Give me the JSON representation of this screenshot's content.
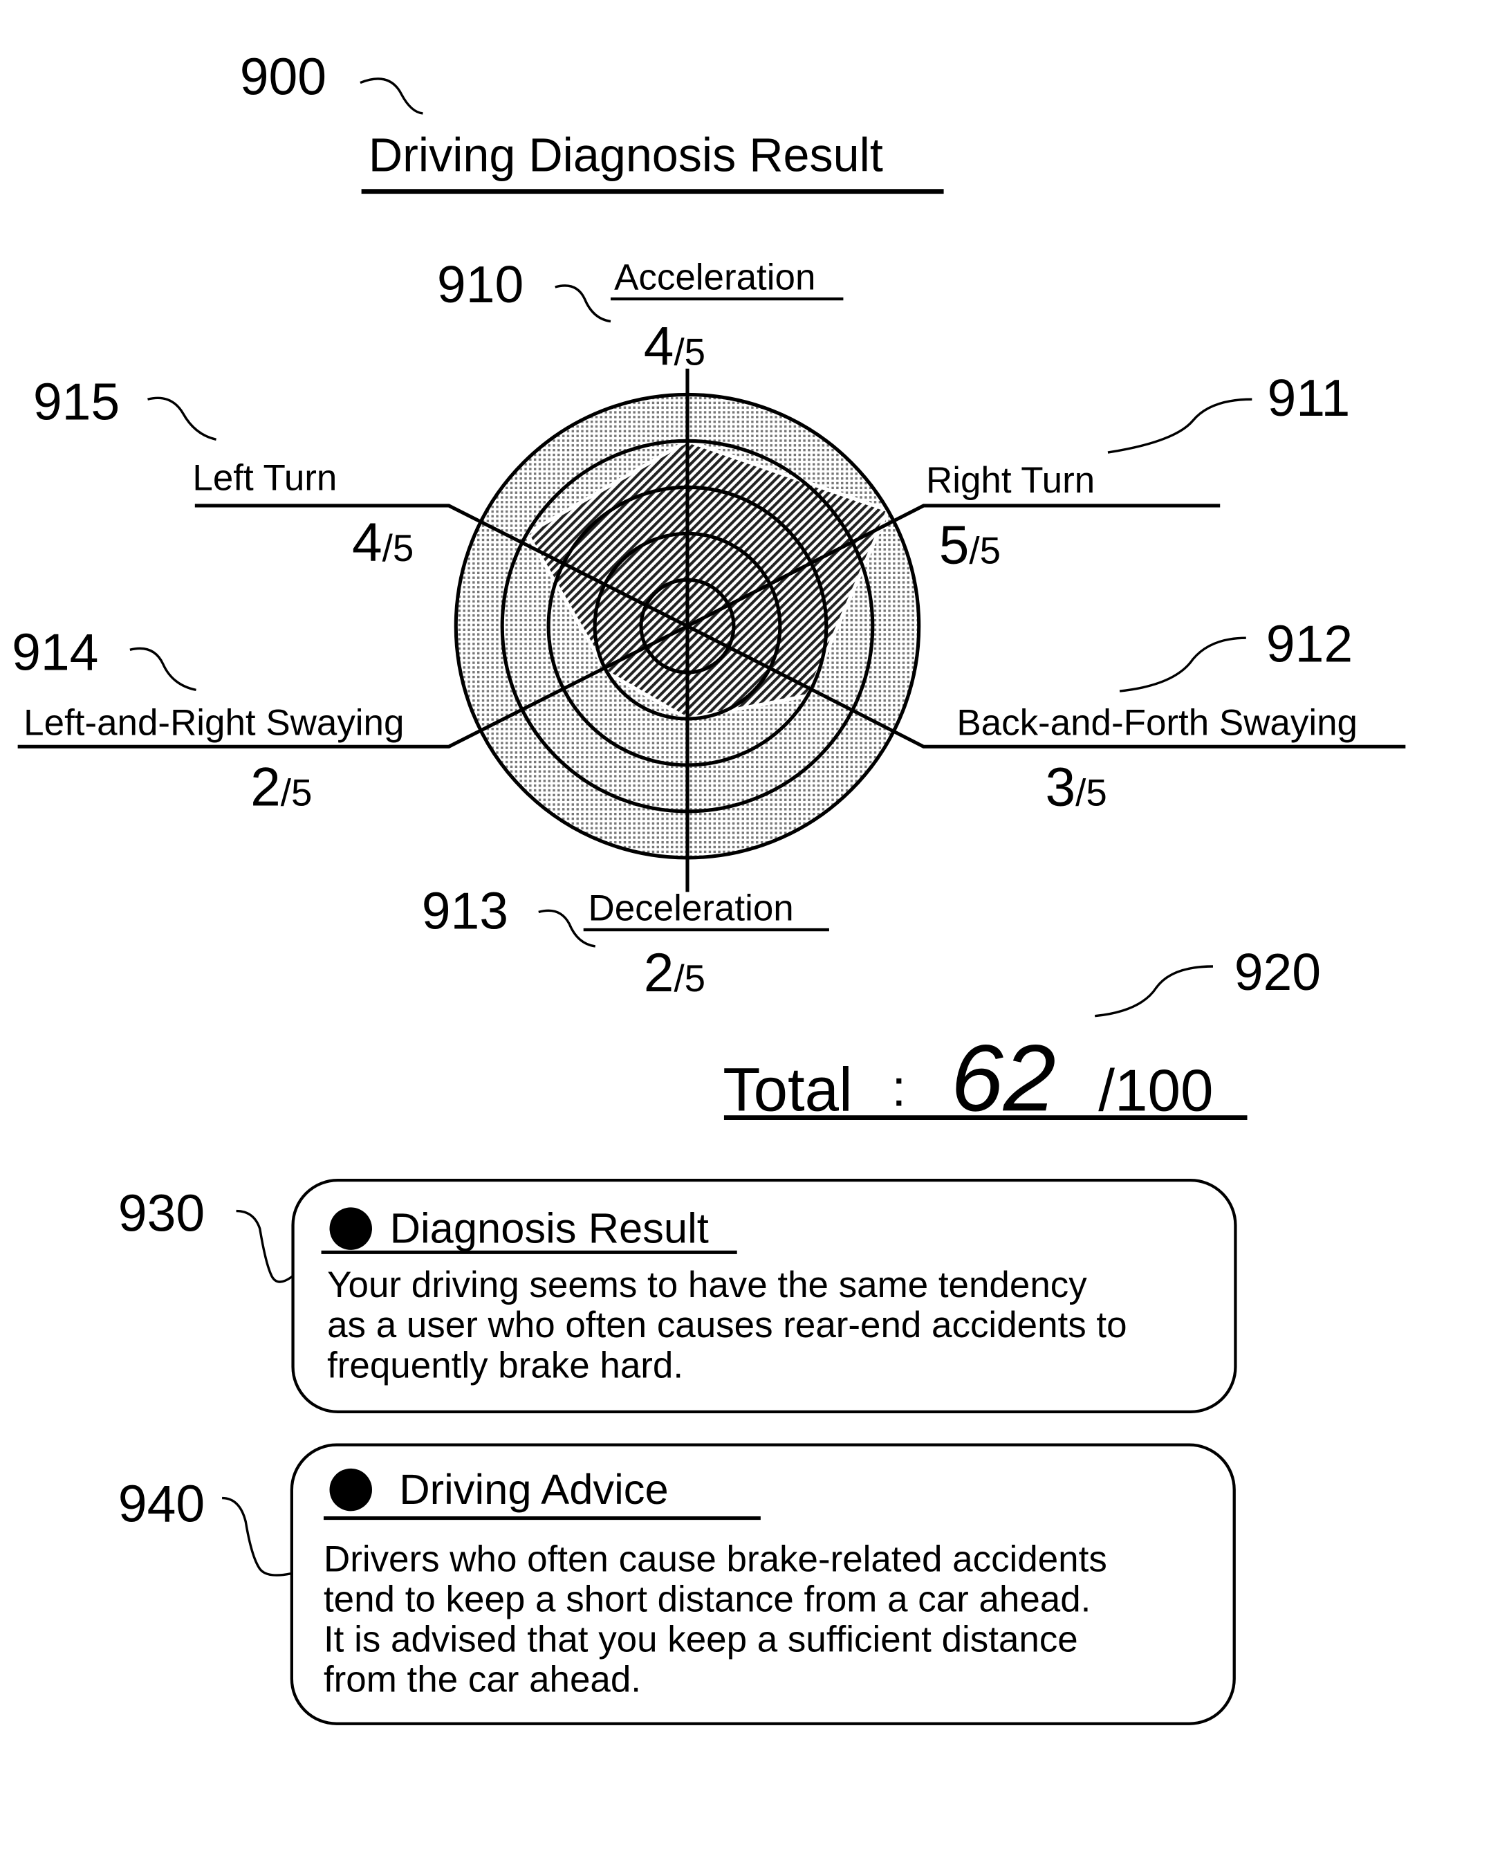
{
  "figure_ref": "900",
  "title": "Driving Diagnosis Result",
  "chart_data": {
    "type": "radar",
    "max": 5,
    "axes": [
      {
        "ref": "910",
        "name": "Acceleration",
        "score": 4,
        "max_label": "/5"
      },
      {
        "ref": "911",
        "name": "Right Turn",
        "score": 5,
        "max_label": "/5"
      },
      {
        "ref": "912",
        "name": "Back-and-Forth Swaying",
        "score": 3,
        "max_label": "/5"
      },
      {
        "ref": "913",
        "name": "Deceleration",
        "score": 2,
        "max_label": "/5"
      },
      {
        "ref": "914",
        "name": "Left-and-Right Swaying",
        "score": 2,
        "max_label": "/5"
      },
      {
        "ref": "915",
        "name": "Left Turn",
        "score": 4,
        "max_label": "/5"
      }
    ]
  },
  "total": {
    "ref": "920",
    "label": "Total",
    "sep": ":",
    "score": "62",
    "max_label": "/100"
  },
  "result_box": {
    "ref": "930",
    "heading": "Diagnosis Result",
    "lines": [
      "Your driving seems to have the same tendency",
      "as a user who often causes rear-end accidents to",
      "frequently brake hard."
    ]
  },
  "advice_box": {
    "ref": "940",
    "heading": "Driving Advice",
    "lines": [
      "Drivers who often cause brake-related accidents",
      "tend to keep a short distance from a car ahead.",
      "It is advised that you keep a sufficient distance",
      "from the car ahead."
    ]
  }
}
